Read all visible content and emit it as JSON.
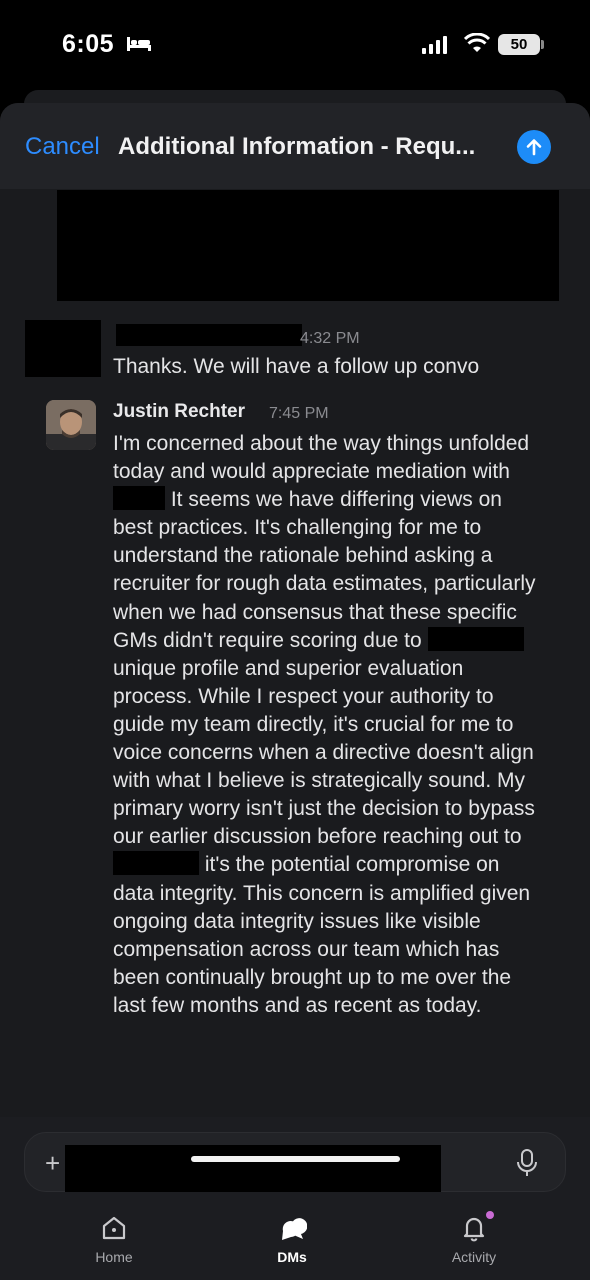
{
  "status_bar": {
    "time": "6:05",
    "battery": "50"
  },
  "header": {
    "cancel_label": "Cancel",
    "title": "Additional Information -  Requ..."
  },
  "messages": [
    {
      "author": "",
      "time": "4:32 PM",
      "text": "Thanks. We will have a follow up convo"
    },
    {
      "author": "Justin Rechter",
      "time": "7:45 PM",
      "segments": [
        "I'm concerned about the way things unfolded today and would appreciate mediation with ",
        " It seems we have differing views on best practices. It's challenging for me to understand the rationale behind asking a recruiter for rough data estimates, particularly when we had consensus that these specific GMs didn't require scoring due to ",
        "unique profile and superior evaluation process. While I respect your authority to guide my team directly, it's crucial for me to voice concerns when a directive doesn't align with what I believe is strategically sound. My primary worry isn't just the decision to bypass our earlier discussion before reaching out to ",
        " it's the potential compromise on data integrity. This concern is amplified given ongoing data integrity issues like visible compensation across our team which has been continually brought up to me over the last few months and as recent as today."
      ]
    }
  ],
  "tabs": [
    {
      "label": "Home",
      "icon": "home-icon"
    },
    {
      "label": "DMs",
      "icon": "dms-icon",
      "active": true
    },
    {
      "label": "Activity",
      "icon": "bell-icon",
      "badge": true
    }
  ],
  "colors": {
    "accent": "#2d8cff",
    "background": "#1a1b1e",
    "badge": "#c96bd4"
  }
}
